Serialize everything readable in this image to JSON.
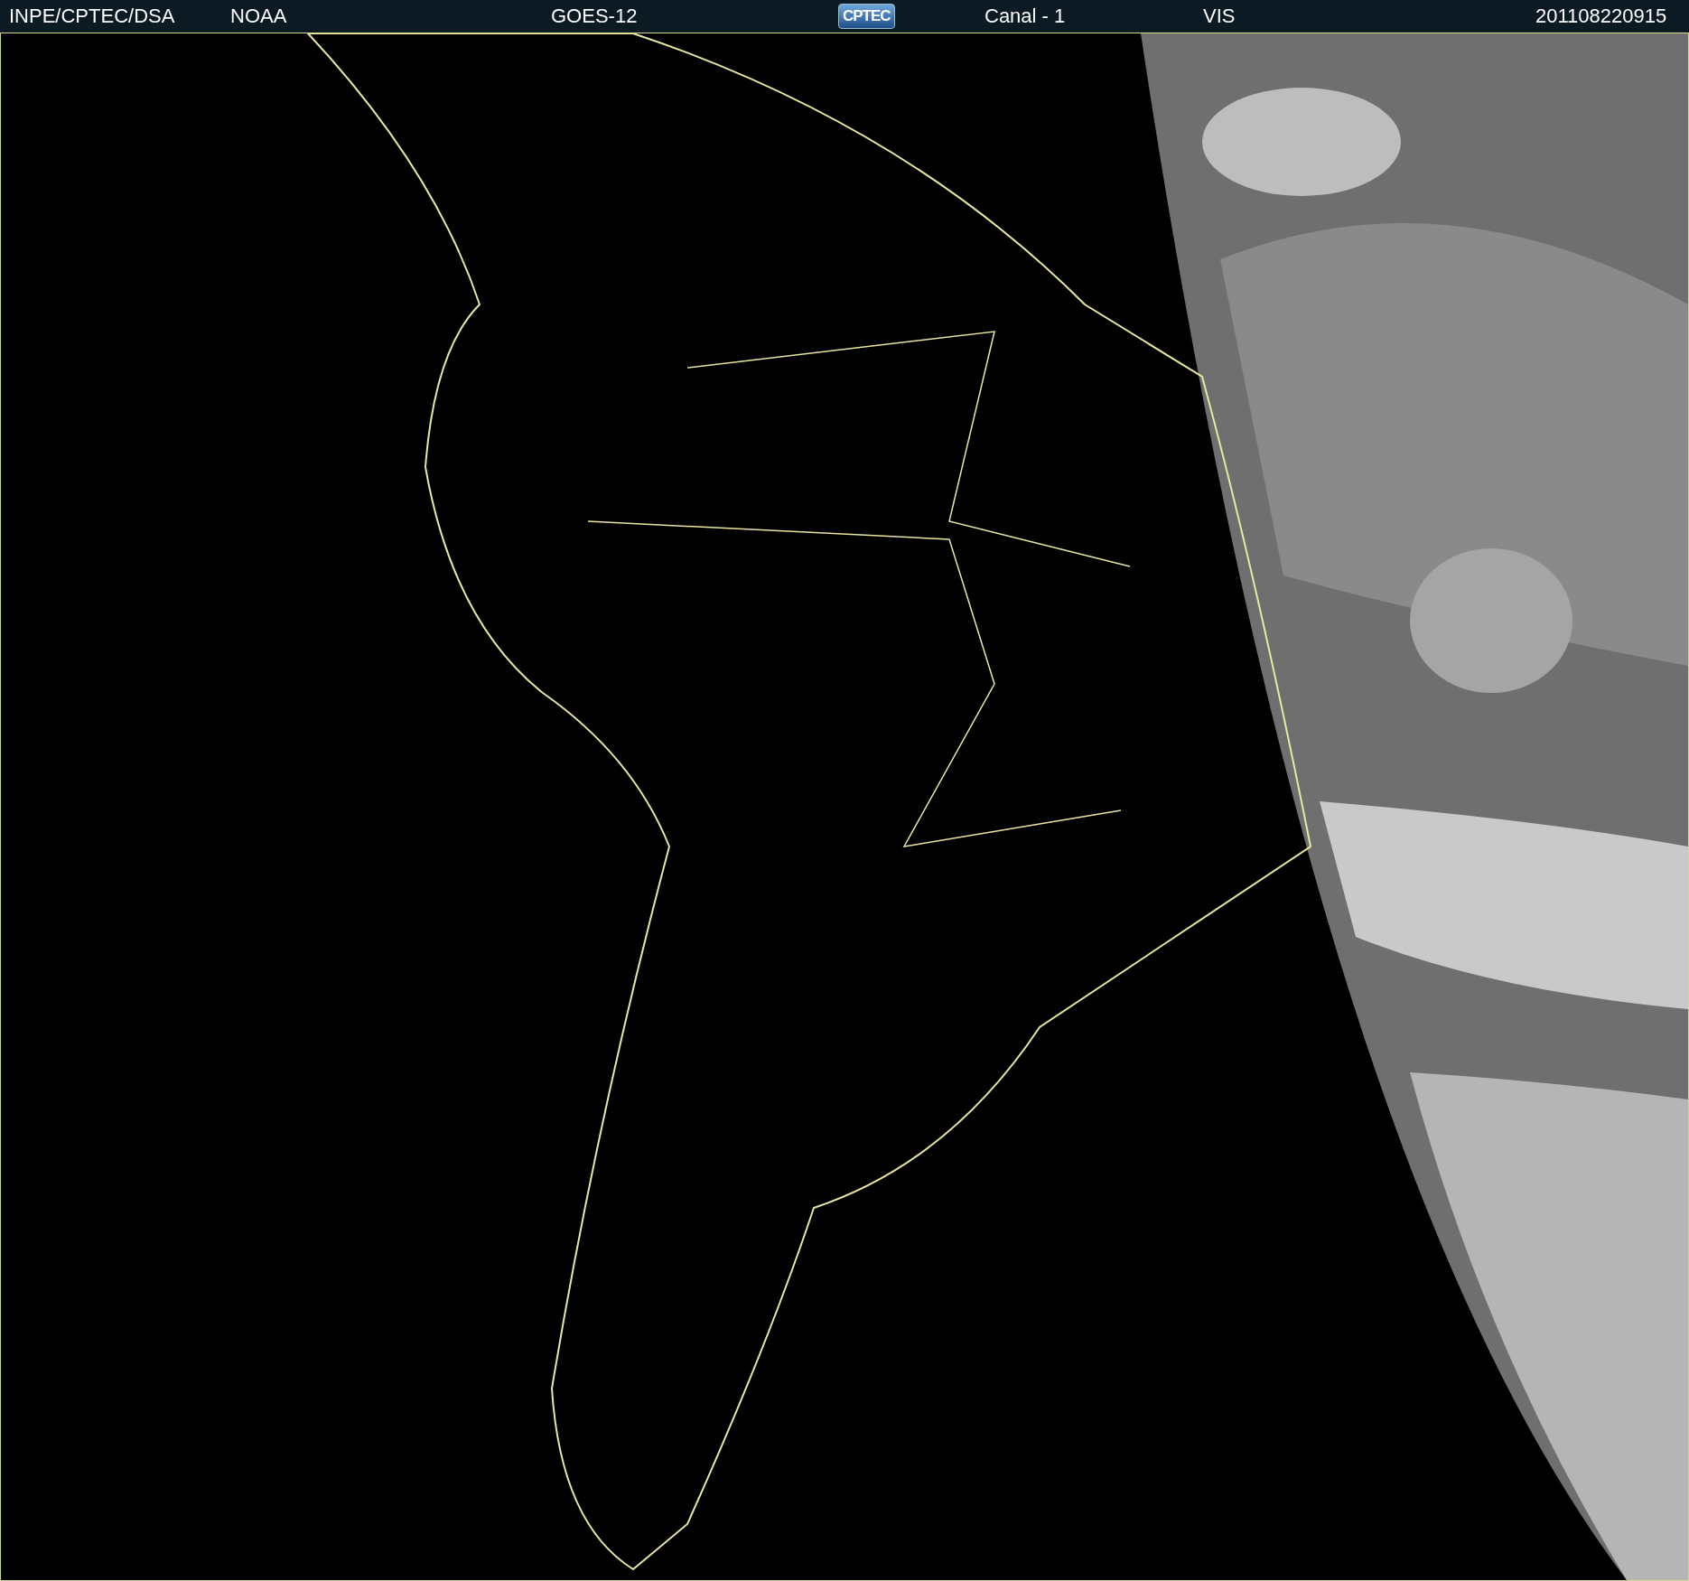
{
  "header": {
    "items": [
      {
        "kind": "text",
        "text": "INPE/CPTEC/DSA"
      },
      {
        "kind": "text",
        "text": "NOAA"
      },
      {
        "kind": "text",
        "text": "GOES-12"
      },
      {
        "kind": "logo",
        "text": "CPTEC"
      },
      {
        "kind": "text",
        "text": "Canal - 1"
      },
      {
        "kind": "text",
        "text": "VIS"
      },
      {
        "kind": "text",
        "text": "201108220915"
      }
    ]
  }
}
